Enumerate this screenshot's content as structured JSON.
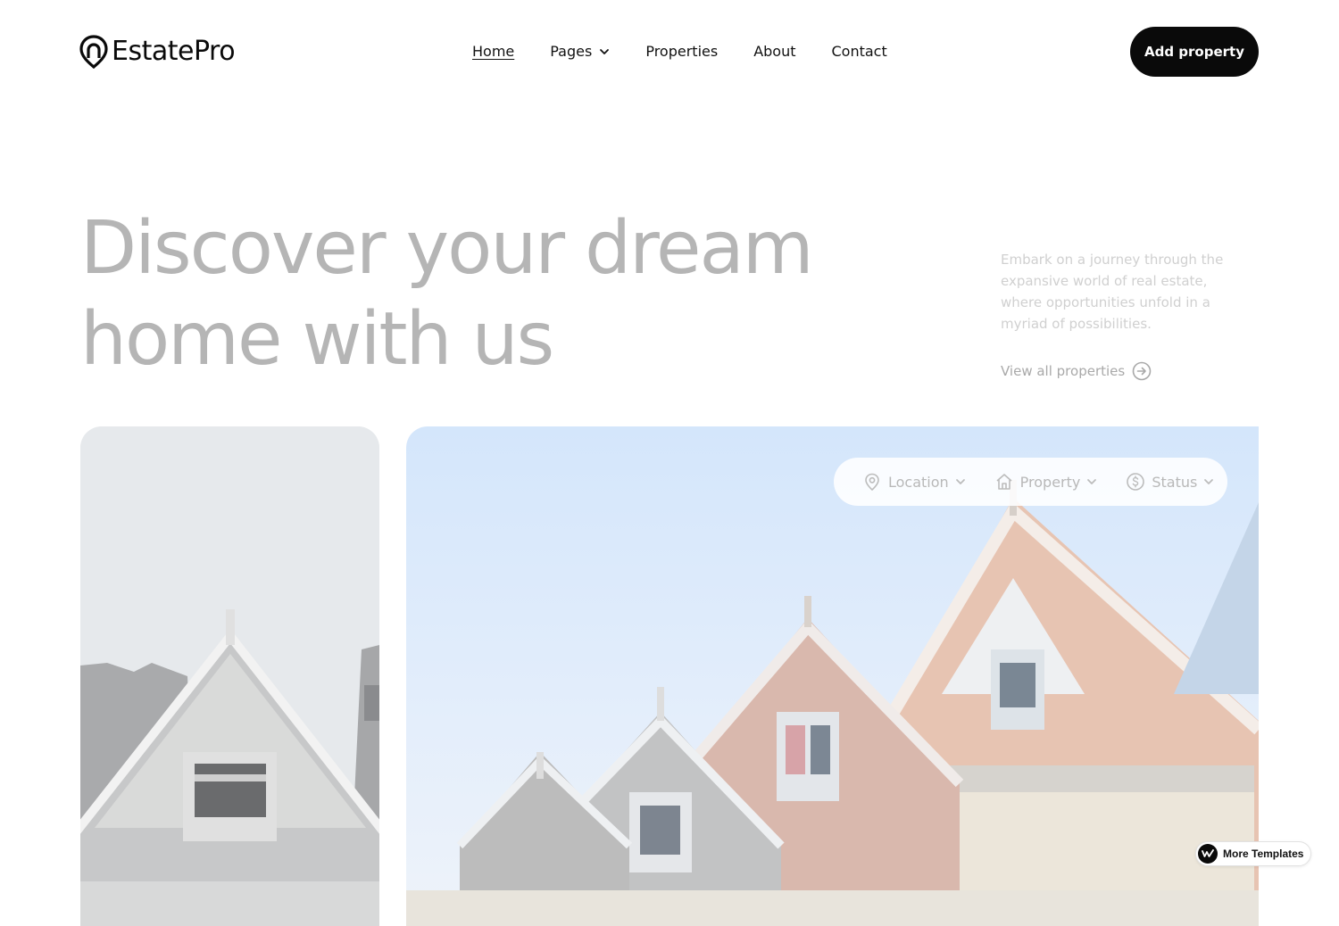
{
  "brand": {
    "name": "EstatePro",
    "accent": "#0a0a0a"
  },
  "nav": {
    "items": [
      {
        "label": "Home",
        "active": true
      },
      {
        "label": "Pages",
        "dropdown": true
      },
      {
        "label": "Properties"
      },
      {
        "label": "About"
      },
      {
        "label": "Contact"
      }
    ]
  },
  "header": {
    "cta_label": "Add property"
  },
  "hero": {
    "title_line1": "Discover your dream",
    "title_line2": "home with us",
    "description": "Embark on a journey through the expansive world of real estate, where opportunities unfold in a myriad of possibilities.",
    "view_all_label": "View all properties"
  },
  "filters": {
    "items": [
      {
        "label": "Location",
        "icon": "map-pin-icon"
      },
      {
        "label": "Property",
        "icon": "home-icon"
      },
      {
        "label": "Status",
        "icon": "dollar-circle-icon"
      }
    ]
  },
  "badge": {
    "label": "More Templates"
  }
}
